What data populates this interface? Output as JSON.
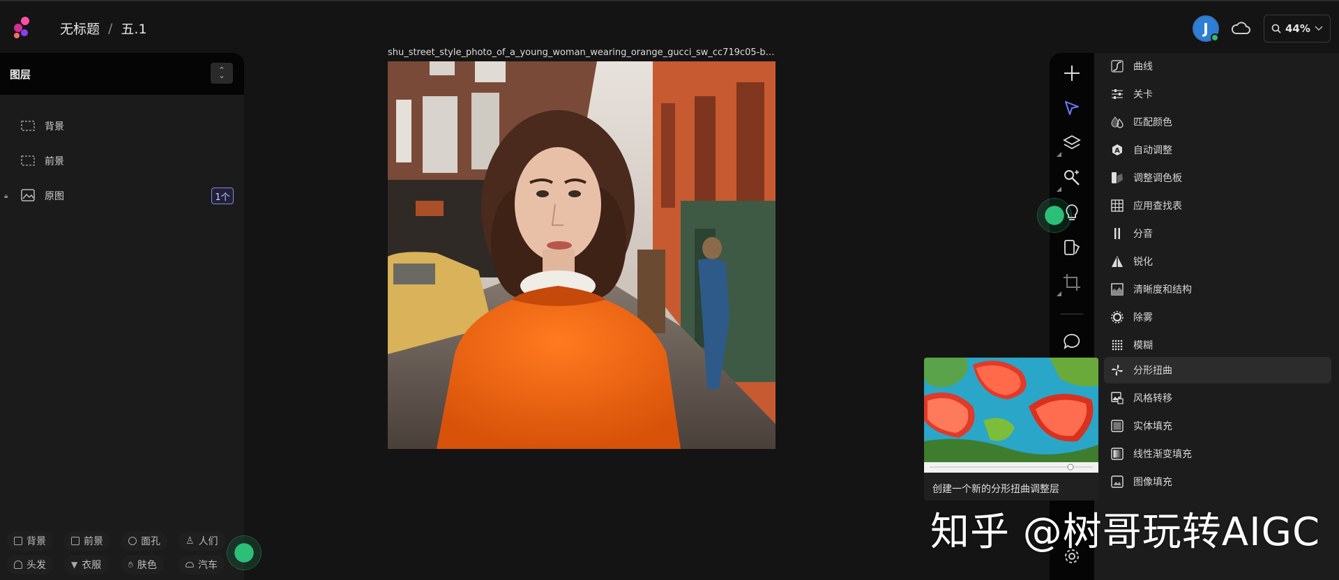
{
  "breadcrumb": {
    "project": "无标题",
    "separator": "/",
    "page": "五.1"
  },
  "account": {
    "initial": "J",
    "status_color": "#2fc06a"
  },
  "zoom": {
    "value": "44%"
  },
  "layers_panel": {
    "title": "图层",
    "items": [
      {
        "name": "背景",
        "icon": "dashed-selection-icon"
      },
      {
        "name": "前景",
        "icon": "dashed-selection-icon"
      },
      {
        "name": "原图",
        "icon": "image-icon",
        "locked": true,
        "badge": "1个"
      }
    ],
    "quick_tags": [
      {
        "label": "背景",
        "icon": "background-icon"
      },
      {
        "label": "前景",
        "icon": "foreground-icon"
      },
      {
        "label": "面孔",
        "icon": "face-icon"
      },
      {
        "label": "人们",
        "icon": "person-icon"
      },
      {
        "label": "头发",
        "icon": "hair-icon"
      },
      {
        "label": "衣服",
        "icon": "shirt-icon"
      },
      {
        "label": "肤色",
        "icon": "hand-icon"
      },
      {
        "label": "汽车",
        "icon": "car-icon"
      }
    ]
  },
  "canvas": {
    "filename": "shu_street_style_photo_of_a_young_woman_wearing_orange_gucci_sw_cc719c05-b8ed-4a..."
  },
  "tools": [
    "plus-icon",
    "select-arrow-icon",
    "layers-stack-icon",
    "magic-search-icon",
    "lightbulb-icon",
    "paint-icon",
    "crop-icon",
    "chat-bubble-icon",
    "settings-gear-icon"
  ],
  "adjust_menu": {
    "items": [
      {
        "label": "曲线",
        "icon": "curve-icon"
      },
      {
        "label": "关卡",
        "icon": "levels-icon"
      },
      {
        "label": "匹配颜色",
        "icon": "match-color-icon"
      },
      {
        "label": "自动调整",
        "icon": "auto-adjust-icon"
      },
      {
        "label": "调整调色板",
        "icon": "palette-icon"
      },
      {
        "label": "应用查找表",
        "icon": "lut-grid-icon"
      },
      {
        "label": "分音",
        "icon": "split-tone-icon"
      },
      {
        "label": "锐化",
        "icon": "sharpen-icon"
      },
      {
        "label": "清晰度和结构",
        "icon": "clarity-icon"
      },
      {
        "label": "除雾",
        "icon": "dehaze-icon"
      },
      {
        "label": "模糊",
        "icon": "blur-icon"
      },
      {
        "label": "分形扭曲",
        "icon": "fractal-icon",
        "active": true
      },
      {
        "label": "风格转移",
        "icon": "style-transfer-icon"
      },
      {
        "label": "实体填充",
        "icon": "solid-fill-icon"
      },
      {
        "label": "线性渐变填充",
        "icon": "gradient-fill-icon"
      },
      {
        "label": "图像填充",
        "icon": "image-fill-icon"
      }
    ]
  },
  "preview": {
    "caption": "创建一个新的分形扭曲调整层"
  },
  "watermark": {
    "text": "知乎 @树哥玩转AIGC"
  },
  "colors": {
    "accent_green": "#2bbf77",
    "badge_purple": "#8a8ad8",
    "select_blue": "#6b7cff"
  }
}
